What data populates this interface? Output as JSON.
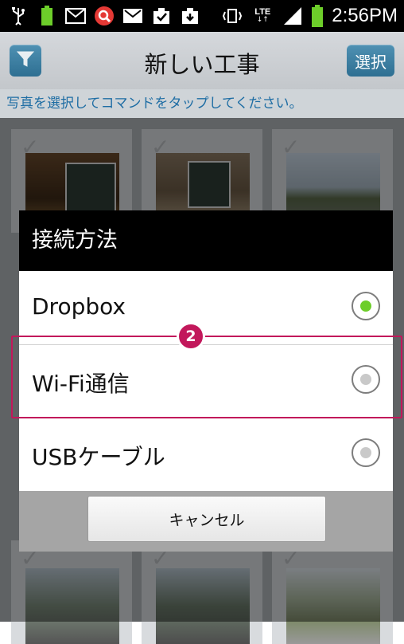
{
  "status_bar": {
    "time": "2:56PM",
    "network": "LTE",
    "left_icons": [
      "usb-icon",
      "battery-small-icon",
      "mail-icon",
      "search-app-icon",
      "gmail-icon",
      "download-done-icon",
      "download-icon"
    ],
    "right_icons": [
      "vibrate-icon",
      "lte-icon",
      "signal-icon",
      "battery-icon"
    ],
    "accent": "#6dce2a"
  },
  "app_bar": {
    "title": "新しい工事",
    "select_label": "選択",
    "filter_icon": "filter-icon"
  },
  "instruction": "写真を選択してコマンドをタップしてください。",
  "dialog": {
    "title": "接続方法",
    "options": [
      {
        "label": "Dropbox",
        "selected": true
      },
      {
        "label": "Wi-Fi通信",
        "selected": false
      },
      {
        "label": "USBケーブル",
        "selected": false
      }
    ],
    "cancel_label": "キャンセル"
  },
  "annotation": {
    "badge": "2",
    "color": "#c2185b"
  }
}
